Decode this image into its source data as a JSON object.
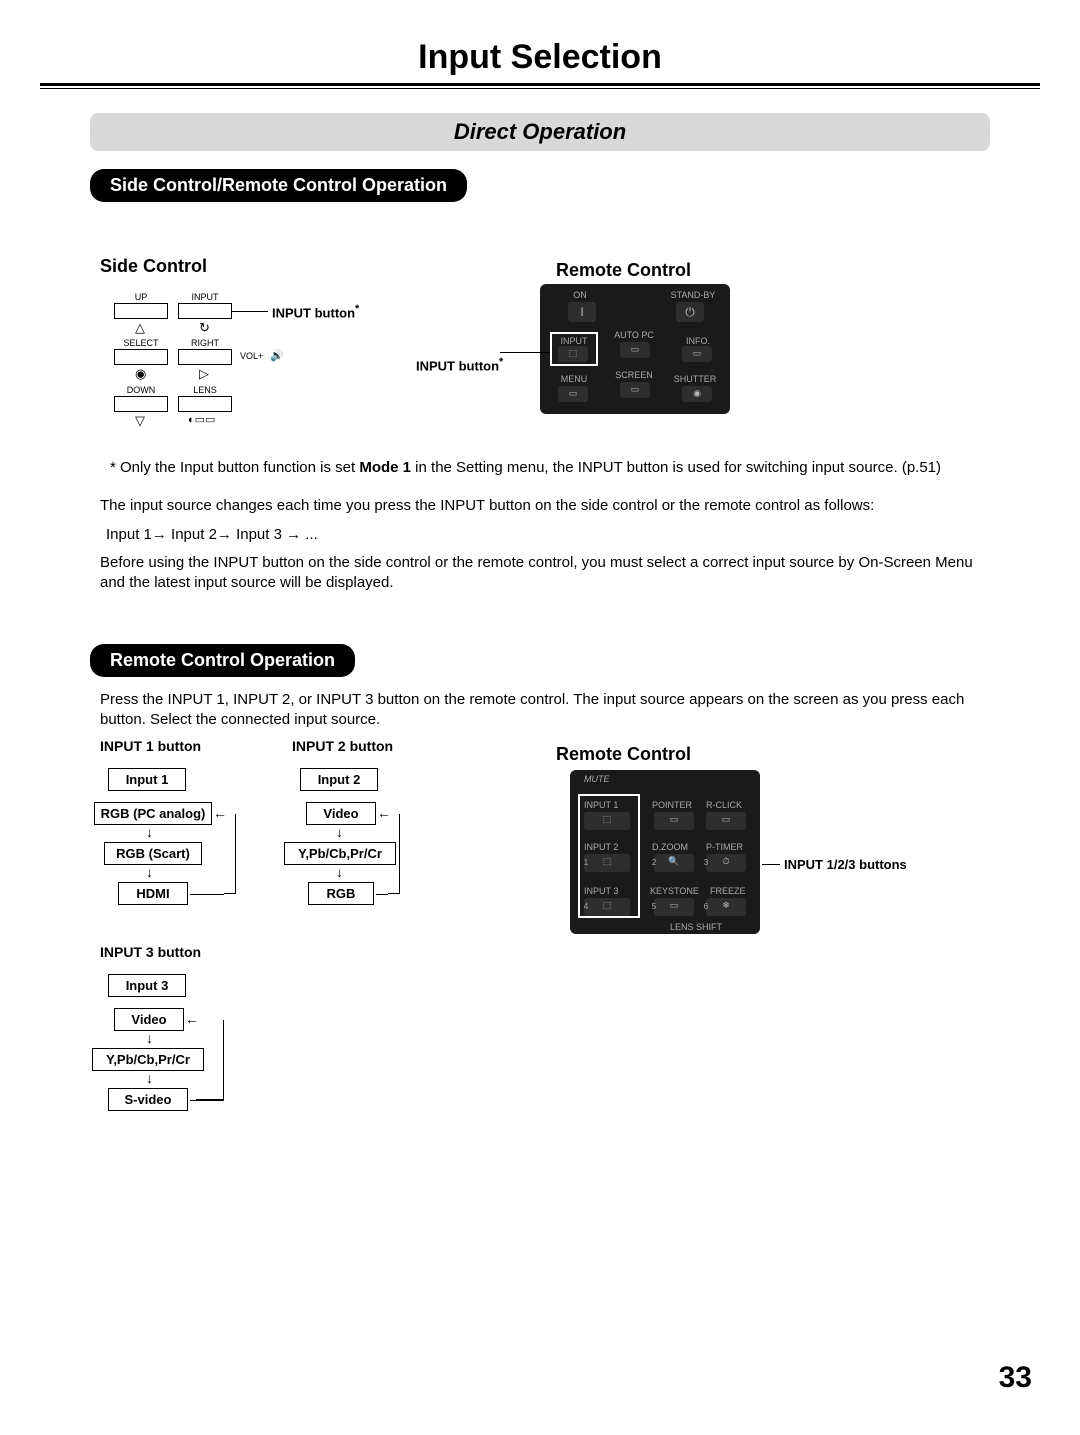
{
  "page_title": "Input Selection",
  "section_direct": "Direct Operation",
  "pill_side_remote": "Side Control/Remote Control Operation",
  "pill_remote": "Remote Control Operation",
  "heading_side_control": "Side Control",
  "heading_remote_control_1": "Remote Control",
  "heading_remote_control_2": "Remote Control",
  "side_control": {
    "up": "UP",
    "input": "INPUT",
    "select": "SELECT",
    "right": "RIGHT",
    "down": "DOWN",
    "lens": "LENS",
    "volplus": "VOL+"
  },
  "callout_input_side": "INPUT button",
  "callout_input_remote": "INPUT button",
  "callout_input_123": "INPUT 1/2/3 buttons",
  "asterisk": "*",
  "note_prefix": "* Only the Input button function is set ",
  "note_bold": "Mode 1",
  "note_suffix": " in the Setting menu, the INPUT button is used for switching input source. (p.51)",
  "para1": "The input source changes each time you press the INPUT button on the side control or the remote control as follows:",
  "para2": "Input 1→ Input 2→ Input 3 → ...",
  "para3": "Before using the INPUT button on the side control or the remote control, you must select a correct input source by On-Screen Menu and the latest input source will be displayed.",
  "para4": "Press the INPUT 1, INPUT 2, or INPUT 3 button on the remote control. The input source appears on the screen as you press each button. Select the connected input source.",
  "flow1": {
    "title": "INPUT 1 button",
    "boxes": [
      "Input 1",
      "RGB (PC analog)",
      "RGB (Scart)",
      "HDMI"
    ]
  },
  "flow2": {
    "title": "INPUT 2 button",
    "boxes": [
      "Input 2",
      "Video",
      "Y,Pb/Cb,Pr/Cr",
      "RGB"
    ]
  },
  "flow3": {
    "title": "INPUT 3 button",
    "boxes": [
      "Input 3",
      "Video",
      "Y,Pb/Cb,Pr/Cr",
      "S-video"
    ]
  },
  "remote1_labels": {
    "on": "ON",
    "standby": "STAND-BY",
    "input": "INPUT",
    "autopc": "AUTO PC",
    "info": "INFO.",
    "menu": "MENU",
    "screen": "SCREEN",
    "shutter": "SHUTTER"
  },
  "remote2_labels": {
    "mute": "MUTE",
    "input1": "INPUT 1",
    "input2": "INPUT 2",
    "input3": "INPUT 3",
    "pointer": "POINTER",
    "rclick": "R-CLICK",
    "dzoom": "D.ZOOM",
    "ptimer": "P-TIMER",
    "keystone": "KEYSTONE",
    "freeze": "FREEZE",
    "lensshift": "LENS SHIFT",
    "n1": "1",
    "n2": "2",
    "n3": "3",
    "n4": "4",
    "n5": "5",
    "n6": "6"
  },
  "page_number": "33"
}
